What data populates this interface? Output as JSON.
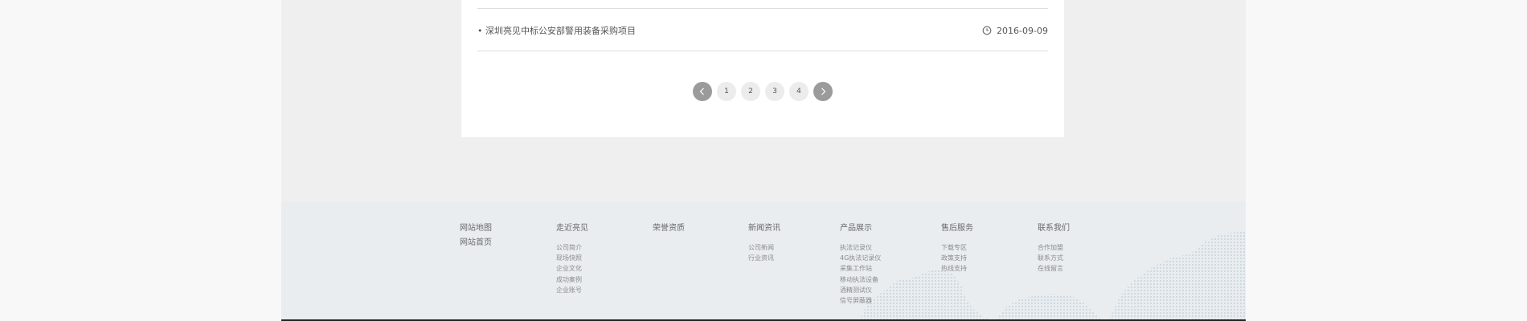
{
  "news": {
    "item_title": "• 深圳亮见中标公安部警用装备采购项目",
    "item_date": "2016-09-09"
  },
  "pagination": {
    "prev_icon": "chevron-left-icon",
    "pages": [
      "1",
      "2",
      "3",
      "4"
    ],
    "next_icon": "chevron-right-icon"
  },
  "footer": {
    "sitemap": {
      "title": "网站地图",
      "home": "网站首页"
    },
    "about": {
      "title": "走近亮见",
      "links": [
        "公司简介",
        "现场快照",
        "企业文化",
        "成功案例",
        "企业账号"
      ]
    },
    "honors": {
      "title": "荣誉资质"
    },
    "news": {
      "title": "新闻资讯",
      "links": [
        "公司新闻",
        "行业资讯"
      ]
    },
    "products": {
      "title": "产品展示",
      "links": [
        "执法记录仪",
        "4G执法记录仪",
        "采集工作站",
        "移动执法设备",
        "酒精测试仪",
        "信号屏蔽器"
      ]
    },
    "service": {
      "title": "售后服务",
      "links": [
        "下载专区",
        "政策支持",
        "热线支持"
      ]
    },
    "contact": {
      "title": "联系我们",
      "links": [
        "合作加盟",
        "联系方式",
        "在线留言"
      ]
    }
  },
  "colors": {
    "page_bg": "#efefef",
    "card_bg": "#ffffff",
    "footer_bg": "#e9edf0",
    "arrow_bg": "#9b9b9b",
    "page_btn_bg": "#ececec"
  }
}
